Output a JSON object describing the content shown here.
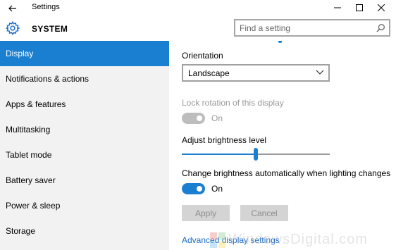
{
  "window": {
    "title": "Settings",
    "controls": {
      "minimize": "minimize-icon",
      "maximize": "maximize-icon",
      "close": "close-icon"
    }
  },
  "header": {
    "title": "SYSTEM",
    "icon": "gear-icon",
    "search": {
      "placeholder": "Find a setting",
      "value": ""
    }
  },
  "sidebar": {
    "items": [
      {
        "label": "Display",
        "selected": true
      },
      {
        "label": "Notifications & actions",
        "selected": false
      },
      {
        "label": "Apps & features",
        "selected": false
      },
      {
        "label": "Multitasking",
        "selected": false
      },
      {
        "label": "Tablet mode",
        "selected": false
      },
      {
        "label": "Battery saver",
        "selected": false
      },
      {
        "label": "Power & sleep",
        "selected": false
      },
      {
        "label": "Storage",
        "selected": false
      }
    ]
  },
  "main": {
    "orientation": {
      "label": "Orientation",
      "value": "Landscape"
    },
    "lock_rotation": {
      "label": "Lock rotation of this display",
      "state_text": "On",
      "enabled": false
    },
    "brightness": {
      "label": "Adjust brightness level",
      "level_percent": 50
    },
    "auto_brightness": {
      "label": "Change brightness automatically when lighting changes",
      "state_text": "On",
      "on": true
    },
    "buttons": {
      "apply": "Apply",
      "cancel": "Cancel"
    },
    "advanced_link": "Advanced display settings"
  },
  "watermark": {
    "text": "WindowsDigital.com"
  },
  "colors": {
    "accent": "#1b7fd1",
    "sidebar_bg": "#f2f2f2",
    "disabled_text": "#999999",
    "link": "#1b6cc6"
  }
}
